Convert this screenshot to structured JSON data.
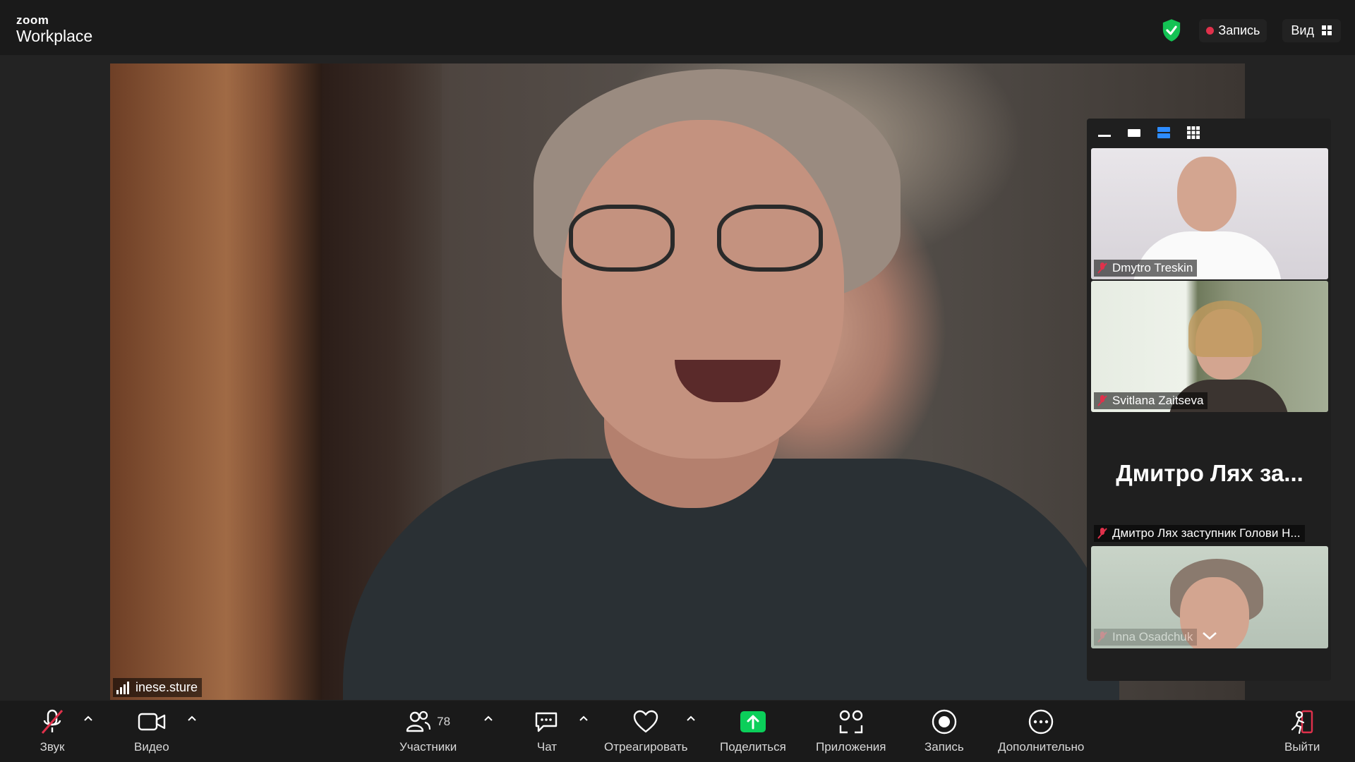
{
  "app": {
    "logo_small": "zoom",
    "logo_big": "Workplace"
  },
  "header": {
    "record_label": "Запись",
    "view_label": "Вид"
  },
  "main_video": {
    "participant": "inese.sture"
  },
  "gallery": {
    "tiles": [
      {
        "name": "Dmytro Treskin"
      },
      {
        "name": "Svitlana Zaitseva"
      },
      {
        "display_name": "Дмитро Лях за...",
        "name": "Дмитро Лях заступник Голови Н..."
      },
      {
        "name": "Inna Osadchuk"
      }
    ]
  },
  "toolbar": {
    "audio": "Звук",
    "video": "Видео",
    "participants": "Участники",
    "participants_count": "78",
    "chat": "Чат",
    "react": "Отреагировать",
    "share": "Поделиться",
    "apps": "Приложения",
    "record": "Запись",
    "more": "Дополнительно",
    "leave": "Выйти"
  },
  "colors": {
    "share_green": "#0bcf5a",
    "mute_red": "#e0314b",
    "active_blue": "#2d8cff"
  }
}
